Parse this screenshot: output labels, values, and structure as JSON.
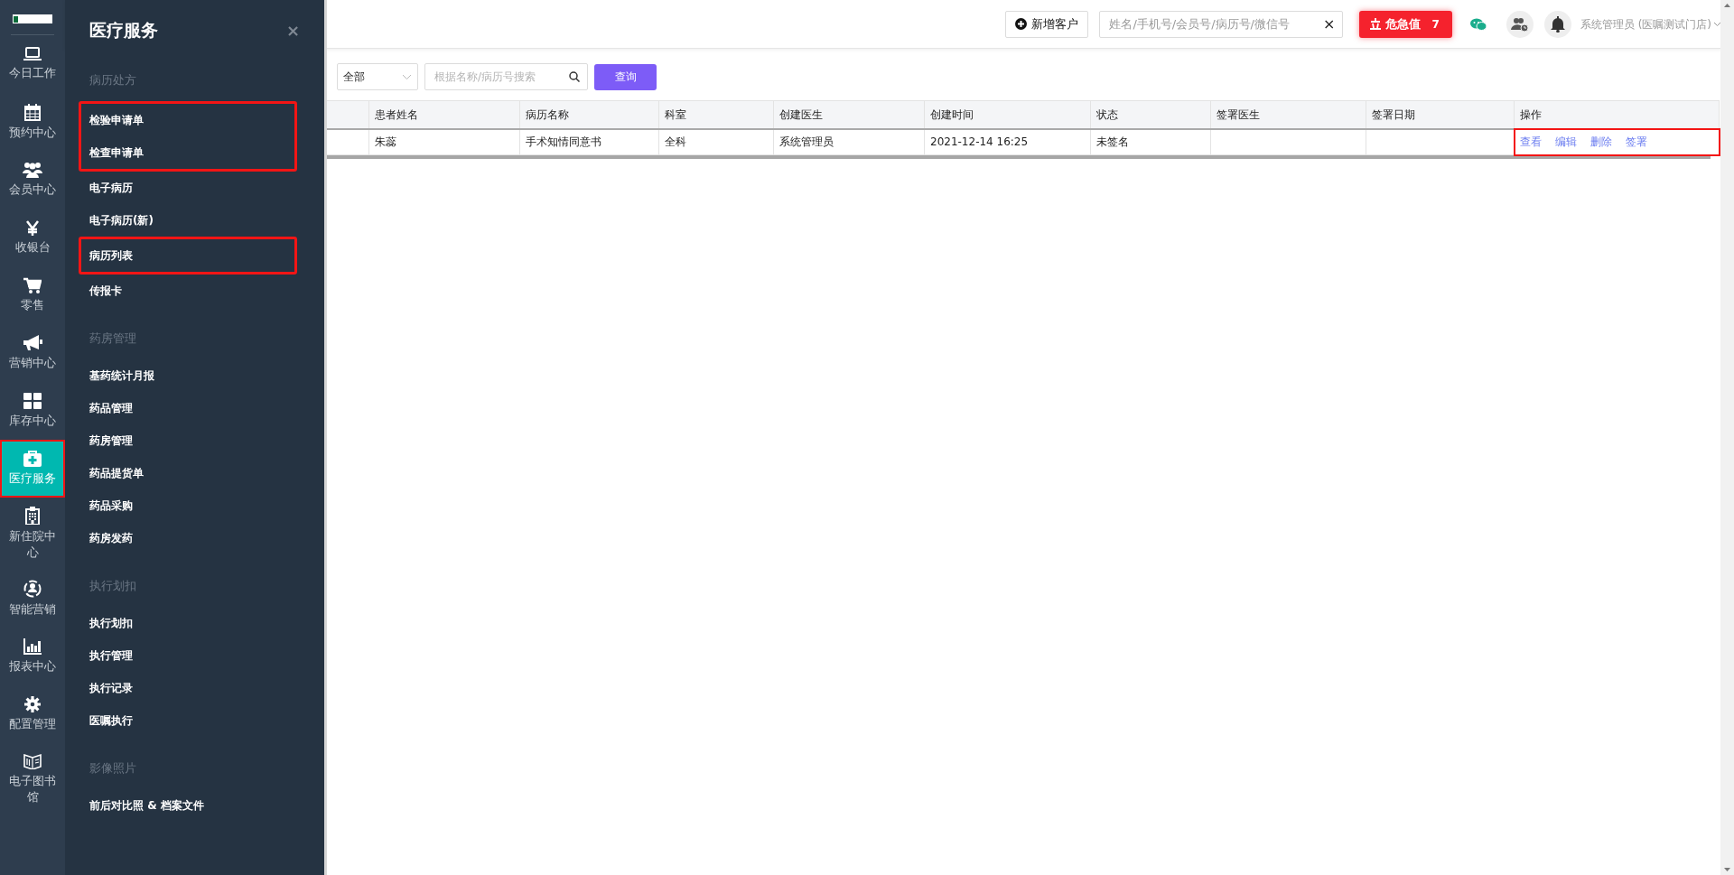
{
  "sidebar": {
    "items": [
      {
        "kind": "laptop",
        "label": "今日工作",
        "selected": false,
        "outlined": false
      },
      {
        "kind": "calendar",
        "label": "预约中心",
        "selected": false,
        "outlined": false
      },
      {
        "kind": "users",
        "label": "会员中心",
        "selected": false,
        "outlined": false
      },
      {
        "kind": "yen",
        "label": "收银台",
        "selected": false,
        "outlined": false
      },
      {
        "kind": "cart",
        "label": "零售",
        "selected": false,
        "outlined": false
      },
      {
        "kind": "megaphone",
        "label": "营销中心",
        "selected": false,
        "outlined": false
      },
      {
        "kind": "grid",
        "label": "库存中心",
        "selected": false,
        "outlined": false
      },
      {
        "kind": "medkit",
        "label": "医疗服务",
        "selected": true,
        "outlined": true
      },
      {
        "kind": "hospital",
        "label": "新住院中心",
        "selected": false,
        "outlined": false
      },
      {
        "kind": "person-circle",
        "label": "智能营销",
        "selected": false,
        "outlined": false
      },
      {
        "kind": "chart",
        "label": "报表中心",
        "selected": false,
        "outlined": false
      },
      {
        "kind": "gear",
        "label": "配置管理",
        "selected": false,
        "outlined": false
      },
      {
        "kind": "book",
        "label": "电子图书馆",
        "selected": false,
        "outlined": false
      }
    ]
  },
  "flyout": {
    "title": "医疗服务",
    "close": "×",
    "sections": [
      {
        "heading": "病历处方",
        "items": [
          {
            "label": "检验申请单",
            "outlined": true
          },
          {
            "label": "检查申请单",
            "outlined": true
          },
          {
            "label": "电子病历",
            "outlined": false
          },
          {
            "label": "电子病历(新)",
            "outlined": false
          },
          {
            "label": "病历列表",
            "outlined": true
          },
          {
            "label": "传报卡",
            "outlined": false
          }
        ]
      },
      {
        "heading": "药房管理",
        "items": [
          {
            "label": "基药统计月报",
            "outlined": false
          },
          {
            "label": "药品管理",
            "outlined": false
          },
          {
            "label": "药房管理",
            "outlined": false
          },
          {
            "label": "药品提货单",
            "outlined": false
          },
          {
            "label": "药品采购",
            "outlined": false
          },
          {
            "label": "药房发药",
            "outlined": false
          }
        ]
      },
      {
        "heading": "执行划扣",
        "items": [
          {
            "label": "执行划扣",
            "outlined": false
          },
          {
            "label": "执行管理",
            "outlined": false
          },
          {
            "label": "执行记录",
            "outlined": false
          },
          {
            "label": "医嘱执行",
            "outlined": false
          }
        ]
      },
      {
        "heading": "影像照片",
        "items": [
          {
            "label": "前后对比照 & 档案文件",
            "outlined": false
          }
        ]
      }
    ]
  },
  "topbar": {
    "add_button": "新增客户",
    "search": {
      "placeholder": "姓名/手机号/会员号/病历号/微信号",
      "clear": "×"
    },
    "alert_button": {
      "label": "危急值",
      "count": "7"
    },
    "user": "系统管理员 (医嘱测试门店)"
  },
  "filter": {
    "select": "全部",
    "search_placeholder": "根据名称/病历号搜索",
    "query_button": "查询"
  },
  "table": {
    "columns": [
      "患者姓名",
      "病历名称",
      "科室",
      "创建医生",
      "创建时间",
      "状态",
      "签署医生",
      "签署日期",
      "操作"
    ],
    "rows": [
      {
        "patient": "朱蕊",
        "record": "手术知情同意书",
        "department": "全科",
        "creator": "系统管理员",
        "created": "2021-12-14 16:25",
        "status": "未签名",
        "actions": [
          "查看",
          "编辑",
          "删除",
          "签署"
        ],
        "actions_outlined": true
      }
    ]
  }
}
